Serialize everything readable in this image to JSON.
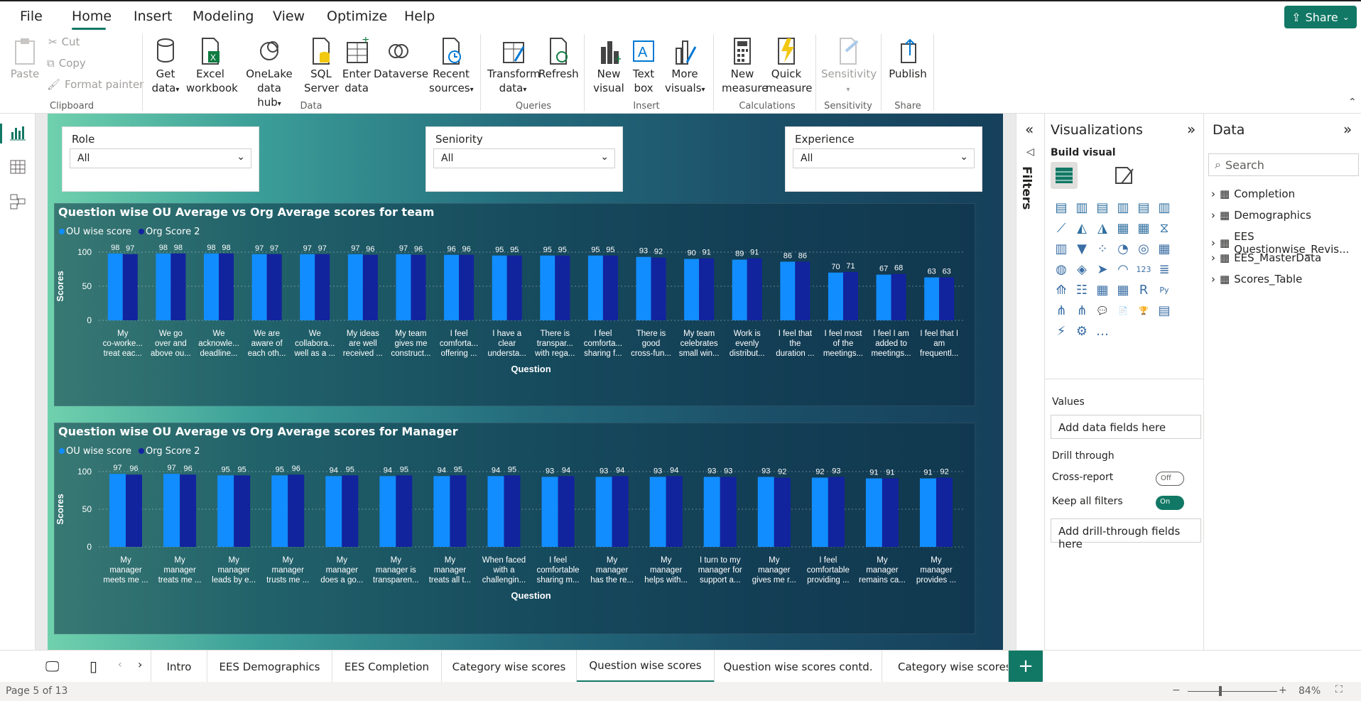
{
  "menu": {
    "tabs": [
      "File",
      "Home",
      "Insert",
      "Modeling",
      "View",
      "Optimize",
      "Help"
    ],
    "active": "Home",
    "share_label": "Share"
  },
  "ribbon": {
    "clipboard": {
      "paste": "Paste",
      "cut": "Cut",
      "copy": "Copy",
      "format_painter": "Format painter",
      "group": "Clipboard"
    },
    "data": {
      "get_data": [
        "Get",
        "data"
      ],
      "excel": [
        "Excel",
        "workbook"
      ],
      "onelake": [
        "OneLake data",
        "hub"
      ],
      "sql": [
        "SQL",
        "Server"
      ],
      "enter": [
        "Enter",
        "data"
      ],
      "dataverse": "Dataverse",
      "recent": [
        "Recent",
        "sources"
      ],
      "group": "Data"
    },
    "queries": {
      "transform": [
        "Transform",
        "data"
      ],
      "refresh": "Refresh",
      "group": "Queries"
    },
    "insert": {
      "new_visual": [
        "New",
        "visual"
      ],
      "text_box": [
        "Text",
        "box"
      ],
      "more_visuals": [
        "More",
        "visuals"
      ],
      "group": "Insert"
    },
    "calculations": {
      "new_measure": [
        "New",
        "measure"
      ],
      "quick_measure": [
        "Quick",
        "measure"
      ],
      "group": "Calculations"
    },
    "sensitivity": {
      "label": "Sensitivity",
      "group": "Sensitivity"
    },
    "share": {
      "publish": "Publish",
      "group": "Share"
    }
  },
  "slicers": [
    {
      "label": "Role",
      "value": "All"
    },
    {
      "label": "Seniority",
      "value": "All"
    },
    {
      "label": "Experience",
      "value": "All"
    }
  ],
  "colors": {
    "ou": "#118dff",
    "org": "#12239e",
    "accent": "#117865"
  },
  "chart_data": [
    {
      "type": "bar",
      "title": "Question wise OU Average vs Org Average scores for team",
      "xlabel": "Question",
      "ylabel": "Scores",
      "ylim": [
        0,
        100
      ],
      "yticks": [
        0,
        50,
        100
      ],
      "categories": [
        [
          "My",
          "co-worke...",
          "treat eac..."
        ],
        [
          "We go",
          "over and",
          "above ou..."
        ],
        [
          "We",
          "acknowle...",
          "deadline..."
        ],
        [
          "We are",
          "aware of",
          "each oth..."
        ],
        [
          "We",
          "collabora...",
          "well as a ..."
        ],
        [
          "My ideas",
          "are well",
          "received ..."
        ],
        [
          "My team",
          "gives me",
          "construct..."
        ],
        [
          "I feel",
          "comforta...",
          "offering ..."
        ],
        [
          "I have a",
          "clear",
          "understa..."
        ],
        [
          "There is",
          "transpar...",
          "with rega..."
        ],
        [
          "I feel",
          "comforta...",
          "sharing f..."
        ],
        [
          "There is",
          "good",
          "cross-fun..."
        ],
        [
          "My team",
          "celebrates",
          "small win..."
        ],
        [
          "Work is",
          "evenly",
          "distribut..."
        ],
        [
          "I feel that",
          "the",
          "duration ..."
        ],
        [
          "I feel most",
          "of the",
          "meetings..."
        ],
        [
          "I feel I am",
          "added to",
          "meetings..."
        ],
        [
          "I feel that I",
          "am",
          "frequentl..."
        ]
      ],
      "series": [
        {
          "name": "OU wise score",
          "values": [
            98,
            98,
            98,
            97,
            97,
            97,
            97,
            96,
            95,
            95,
            95,
            93,
            90,
            89,
            86,
            70,
            67,
            63
          ]
        },
        {
          "name": "Org Score 2",
          "values": [
            97,
            98,
            98,
            97,
            97,
            96,
            96,
            96,
            95,
            95,
            95,
            92,
            91,
            91,
            86,
            71,
            68,
            63
          ]
        }
      ]
    },
    {
      "type": "bar",
      "title": "Question wise OU Average vs Org Average scores for Manager",
      "xlabel": "Question",
      "ylabel": "Scores",
      "ylim": [
        0,
        100
      ],
      "yticks": [
        0,
        50,
        100
      ],
      "categories": [
        [
          "My",
          "manager",
          "meets me ..."
        ],
        [
          "My",
          "manager",
          "treats me ..."
        ],
        [
          "My",
          "manager",
          "leads by e..."
        ],
        [
          "My",
          "manager",
          "trusts me ..."
        ],
        [
          "My",
          "manager",
          "does a go..."
        ],
        [
          "My",
          "manager is",
          "transparen..."
        ],
        [
          "My",
          "manager",
          "treats all t..."
        ],
        [
          "When faced",
          "with a",
          "challengin..."
        ],
        [
          "I feel",
          "comfortable",
          "sharing m..."
        ],
        [
          "My",
          "manager",
          "has the re..."
        ],
        [
          "My",
          "manager",
          "helps with..."
        ],
        [
          "I turn to my",
          "manager for",
          "support a..."
        ],
        [
          "My",
          "manager",
          "gives me r..."
        ],
        [
          "I feel",
          "comfortable",
          "providing ..."
        ],
        [
          "My",
          "manager",
          "remains ca..."
        ],
        [
          "My",
          "manager",
          "provides ..."
        ]
      ],
      "series": [
        {
          "name": "OU wise score",
          "values": [
            97,
            97,
            95,
            95,
            94,
            94,
            94,
            94,
            93,
            93,
            93,
            93,
            93,
            92,
            91,
            91
          ]
        },
        {
          "name": "Org Score 2",
          "values": [
            96,
            96,
            95,
            96,
            95,
            95,
            95,
            95,
            94,
            94,
            94,
            93,
            92,
            93,
            91,
            92
          ]
        }
      ]
    }
  ],
  "filters_label": "Filters",
  "viz": {
    "title": "Visualizations",
    "build": "Build visual",
    "values_label": "Values",
    "values_placeholder": "Add data fields here",
    "drill": "Drill through",
    "cross_report": "Cross-report",
    "cross_state": "Off",
    "keep_filters": "Keep all filters",
    "keep_state": "On",
    "drill_placeholder": "Add drill-through fields here"
  },
  "data": {
    "title": "Data",
    "search_placeholder": "Search",
    "tables": [
      "Completion",
      "Demographics",
      "EES Questionwise_Revis...",
      "EES_MasterData",
      "Scores_Table"
    ]
  },
  "pages": [
    "Intro",
    "EES Demographics",
    "EES Completion",
    "Category wise scores",
    "Question wise scores",
    "Question wise scores contd.",
    "Category wise scores (M"
  ],
  "active_page": "Question wise scores",
  "status": {
    "page": "Page 5 of 13",
    "zoom": "84%"
  }
}
